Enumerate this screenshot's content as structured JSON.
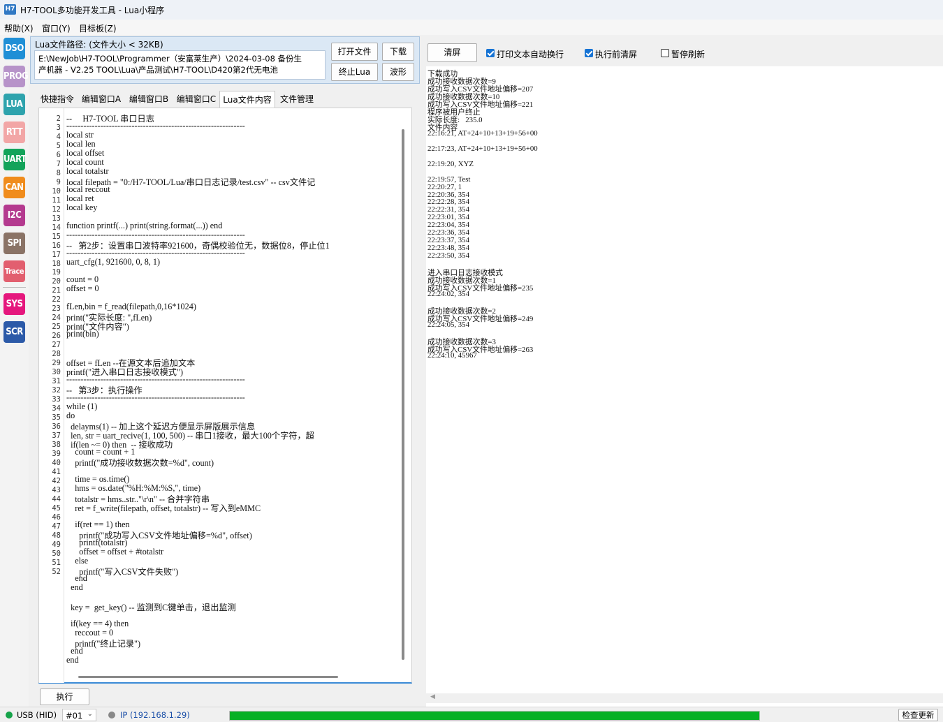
{
  "window": {
    "icon_text": "H7",
    "title": "H7-TOOL多功能开发工具 - Lua小程序"
  },
  "menu": [
    "帮助(X)",
    "窗口(Y)",
    "目标板(Z)"
  ],
  "sidebar": [
    {
      "label": "DSO",
      "color": "#1f8fd6"
    },
    {
      "label": "PROG",
      "color": "#b793c9"
    },
    {
      "label": "LUA",
      "color": "#2ea3ad"
    },
    {
      "label": "RTT",
      "color": "#f2a6a6"
    },
    {
      "label": "UART",
      "color": "#13a35a"
    },
    {
      "label": "CAN",
      "color": "#f08c1c"
    },
    {
      "label": "I2C",
      "color": "#b43a8f"
    },
    {
      "label": "SPI",
      "color": "#8a7366"
    },
    {
      "label": "Trace",
      "color": "#e25f6f"
    },
    {
      "label": "SYS",
      "color": "#e5177d"
    },
    {
      "label": "SCR",
      "color": "#2c5aa8"
    }
  ],
  "file": {
    "path_label": "Lua文件路径: (文件大小 < 32KB)",
    "path_line1": "E:\\NewJob\\H7-TOOL\\Programmer（安富莱生产）\\2024-03-08 备份生",
    "path_line2": "产机器 - V2.25 TOOL\\Lua\\产品测试\\H7-TOOL\\D420第2代无电池",
    "open_btn": "打开文件",
    "download_btn": "下载",
    "stop_btn": "终止Lua",
    "wave_btn": "波形"
  },
  "tabs": [
    "快捷指令",
    "编辑窗口A",
    "编辑窗口B",
    "编辑窗口C",
    "Lua文件内容",
    "文件管理"
  ],
  "active_tab": 4,
  "line_numbers": [
    "2",
    "3",
    "4",
    "5",
    "6",
    "7",
    "8",
    "9",
    "10",
    "11",
    "12",
    "13",
    "14",
    "15",
    "16",
    "17",
    "18",
    "19",
    "20",
    "21",
    "22",
    "23",
    "24",
    "25",
    "26",
    "27",
    "28",
    "29",
    "30",
    "31",
    "32",
    "33",
    "34",
    "35",
    "36",
    "37",
    "38",
    "39",
    "40",
    "41",
    "42",
    "43",
    "44",
    "45",
    "46",
    "47",
    "48",
    "49",
    "50",
    "51",
    "52"
  ],
  "code": [
    "--     H7-TOOL 串口日志",
    "---------------------------------------------------------------",
    "local str",
    "local len",
    "local offset",
    "local count",
    "local totalstr",
    "local filepath = \"0:/H7-TOOL/Lua/串口日志记录/test.csv\" -- csv文件记",
    "local reccout",
    "local ret",
    "local key",
    "",
    "function printf(...) print(string.format(...)) end",
    "---------------------------------------------------------------",
    "--   第2步：设置串口波特率921600，奇偶校验位无，数据位8，停止位1",
    "---------------------------------------------------------------",
    "uart_cfg(1, 921600, 0, 8, 1)",
    "",
    "count = 0",
    "offset = 0",
    "",
    "fLen,bin = f_read(filepath,0,16*1024)",
    "print(\"实际长度: \",fLen)",
    "print(\"文件内容\")",
    "print(bin)",
    "",
    "",
    "offset = fLen --在源文本后追加文本",
    "printf(\"进入串口日志接收模式\")",
    "---------------------------------------------------------------",
    "--   第3步：执行操作",
    "---------------------------------------------------------------",
    "while (1)",
    "do",
    "  delayms(1) -- 加上这个延迟方便显示屏版展示信息",
    "  len, str = uart_recive(1, 100, 500) -- 串口1接收，最大100个字符，超",
    "  if(len ~= 0) then  -- 接收成功",
    "    count = count + 1",
    "    printf(\"成功接收数据次数=%d\", count)",
    "",
    "    time = os.time()",
    "    hms = os.date(\"%H:%M:%S,\", time)",
    "    totalstr = hms..str..\"\\r\\n\" -- 合并字符串",
    "    ret = f_write(filepath, offset, totalstr) -- 写入到eMMC",
    "",
    "    if(ret == 1) then",
    "      printf(\"成功写入CSV文件地址偏移=%d\", offset)",
    "      printf(totalstr)",
    "      offset = offset + #totalstr",
    "    else",
    "      printf(\"写入CSV文件失败\")",
    "    end",
    "  end",
    "",
    "  key =  get_key() -- 监测到C键单击，退出监测",
    "",
    "  if(key == 4) then",
    "    reccout = 0",
    "    printf(\"终止记录\")",
    "  end",
    "end"
  ],
  "run_btn": "执行",
  "right": {
    "clear_btn": "清屏",
    "opt_wrap": {
      "label": "打印文本自动换行",
      "checked": true
    },
    "opt_clear": {
      "label": "执行前清屏",
      "checked": true
    },
    "opt_pause": {
      "label": "暂停刷新",
      "checked": false
    }
  },
  "log": [
    "下载成功",
    "成功接收数据次数=9",
    "成功写入CSV文件地址偏移=207",
    "成功接收数据次数=10",
    "成功写入CSV文件地址偏移=221",
    "程序被用户终止",
    "实际长度:   235.0",
    "文件内容",
    "22:16:21, AT+24+10+13+19+56+00",
    "",
    "22:17:23, AT+24+10+13+19+56+00",
    "",
    "22:19:20, XYZ",
    "",
    "22:19:57, Test",
    "22:20:27, 1",
    "22:20:36, 354",
    "22:22:28, 354",
    "22:22:31, 354",
    "22:23:01, 354",
    "22:23:04, 354",
    "22:23:36, 354",
    "22:23:37, 354",
    "22:23:48, 354",
    "22:23:50, 354",
    "",
    "进入串口日志接收模式",
    "成功接收数据次数=1",
    "成功写入CSV文件地址偏移=235",
    "22:24:02, 354",
    "",
    "成功接收数据次数=2",
    "成功写入CSV文件地址偏移=249",
    "22:24:05, 354",
    "",
    "成功接收数据次数=3",
    "成功写入CSV文件地址偏移=263",
    "22:24:10, 45967"
  ],
  "status": {
    "usb": "USB (HID)",
    "device": "#01",
    "ip": "IP (192.168.1.29)",
    "progress": 1.0,
    "update_btn": "检查更新",
    "ok_color": "#16a34a"
  }
}
